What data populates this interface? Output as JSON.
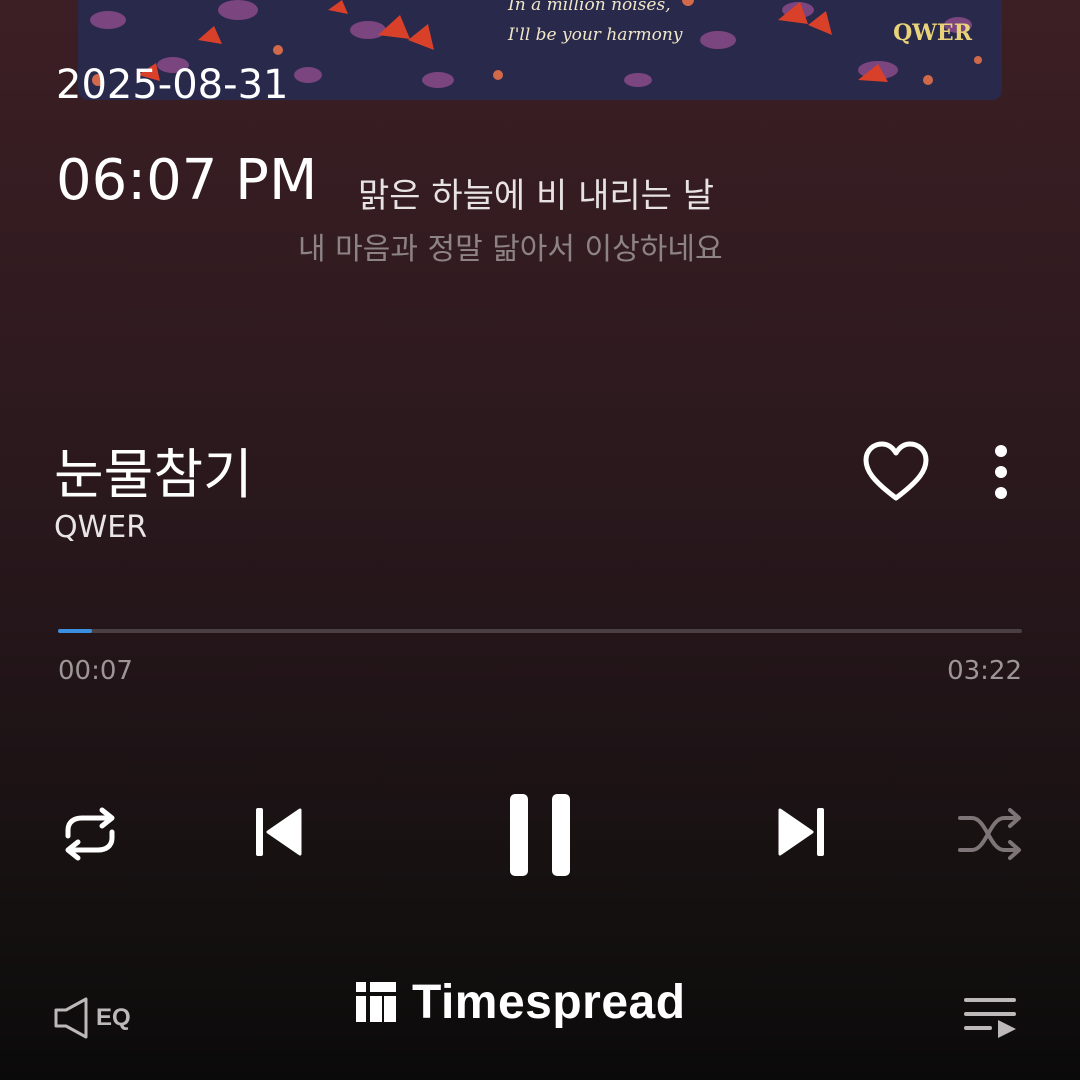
{
  "album_art": {
    "script_line1": "In a million noises,",
    "script_line2": "I'll be your harmony",
    "logo": "QWER"
  },
  "status": {
    "date": "2025-08-31",
    "time": "06:07 PM"
  },
  "lyrics": {
    "current": "맑은 하늘에 비 내리는 날",
    "next": "내 마음과 정말 닮아서 이상하네요"
  },
  "track": {
    "title": "눈물참기",
    "artist": "QWER",
    "elapsed": "00:07",
    "duration": "03:22",
    "progress_fraction": 0.035
  },
  "controls": {
    "repeat": "repeat-icon",
    "previous": "skip-previous-icon",
    "play_pause": "pause-icon",
    "next": "skip-next-icon",
    "shuffle": "shuffle-icon"
  },
  "footer": {
    "eq_label": "EQ",
    "brand": "Timespread"
  },
  "colors": {
    "accent": "#3a8fe0",
    "background_top": "#3c1f24",
    "background_bottom": "#0b0a0a"
  }
}
